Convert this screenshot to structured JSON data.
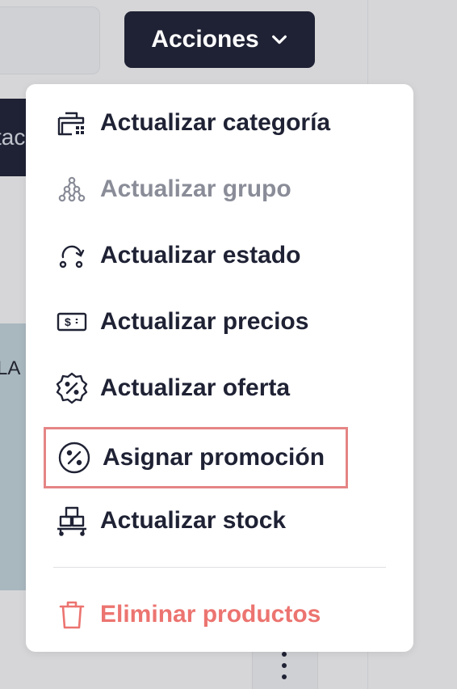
{
  "toolbar": {
    "actions_button": {
      "label": "Acciones",
      "icon": "chevron-down-icon"
    }
  },
  "background": {
    "partial_header_text": "tac",
    "partial_row_text": "LA"
  },
  "actions_menu": {
    "items": [
      {
        "label": "Actualizar categoría",
        "icon": "category-icon",
        "enabled": true
      },
      {
        "label": "Actualizar grupo",
        "icon": "group-tree-icon",
        "enabled": false
      },
      {
        "label": "Actualizar estado",
        "icon": "status-cycle-icon",
        "enabled": true
      },
      {
        "label": "Actualizar precios",
        "icon": "price-tag-icon",
        "enabled": true
      },
      {
        "label": "Actualizar oferta",
        "icon": "offer-badge-icon",
        "enabled": true
      },
      {
        "label": "Asignar promoción",
        "icon": "promotion-percent-icon",
        "enabled": true,
        "highlighted": true
      },
      {
        "label": "Actualizar stock",
        "icon": "stock-boxes-icon",
        "enabled": true
      }
    ],
    "delete": {
      "label": "Eliminar productos",
      "icon": "trash-icon"
    }
  },
  "colors": {
    "primary": "#1f2234",
    "disabled": "#8a8d98",
    "danger": "#ec7470",
    "highlight_border": "#e58585"
  }
}
